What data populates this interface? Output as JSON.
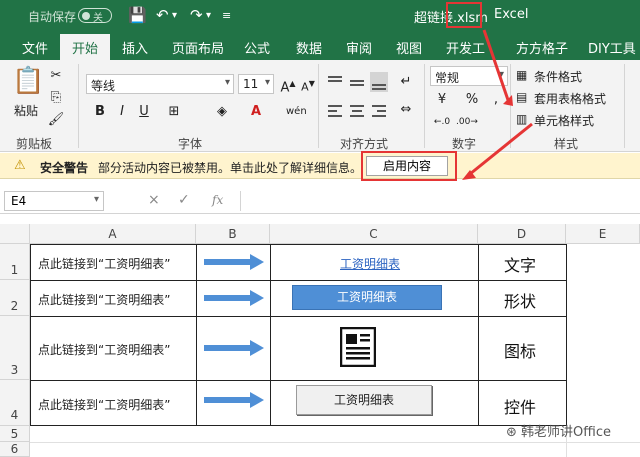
{
  "titlebar": {
    "autosave_label": "自动保存",
    "autosave_state": "关",
    "filename": "超链接.xlsm",
    "appname": "Excel"
  },
  "tabs": [
    "文件",
    "开始",
    "插入",
    "页面布局",
    "公式",
    "数据",
    "审阅",
    "视图",
    "开发工",
    "方方格子",
    "DIY工具箱"
  ],
  "active_tab": "开始",
  "ribbon": {
    "clipboard": {
      "paste_label": "粘贴",
      "group_label": "剪贴板"
    },
    "font": {
      "font_name": "等线",
      "font_size": "11",
      "bold": "B",
      "italic": "I",
      "underline": "U",
      "group_label": "字体"
    },
    "alignment": {
      "group_label": "对齐方式"
    },
    "number": {
      "format": "常规",
      "group_label": "数字"
    },
    "styles": {
      "conditional": "条件格式",
      "table": "套用表格格式",
      "cell": "单元格样式",
      "group_label": "样式"
    }
  },
  "security_bar": {
    "title": "安全警告",
    "message": "部分活动内容已被禁用。单击此处了解详细信息。",
    "enable_button": "启用内容"
  },
  "formula_bar": {
    "name_box": "E4",
    "fx": "fx",
    "cancel": "×",
    "confirm": "✓"
  },
  "columns": [
    "A",
    "B",
    "C",
    "D",
    "E"
  ],
  "rows": [
    "1",
    "2",
    "3",
    "4",
    "5",
    "6"
  ],
  "sheet": {
    "a_text": "点此链接到“工资明细表”",
    "c1_link": "工资明细表",
    "c2_shape": "工资明细表",
    "c4_control": "工资明细表",
    "d1": "文字",
    "d2": "形状",
    "d3": "图标",
    "d4": "控件"
  },
  "watermark": "韩老师讲Office",
  "colors": {
    "accent": "#217346",
    "warning_bg": "#fff4ce",
    "highlight": "#e53535",
    "shape_blue": "#4f8fd6"
  }
}
